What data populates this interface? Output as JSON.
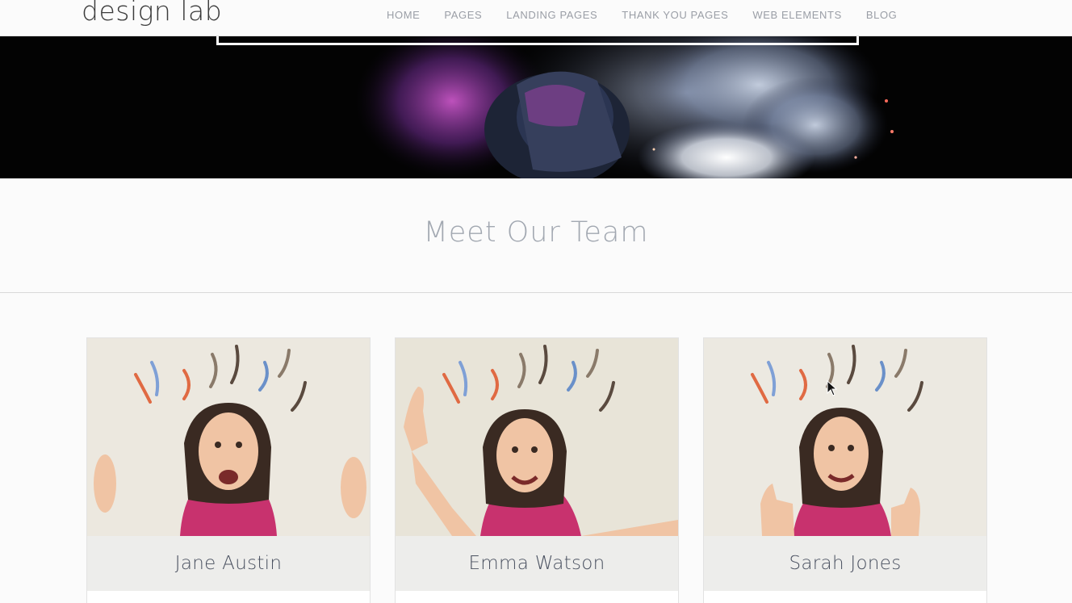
{
  "header": {
    "logo": "design lab",
    "nav": [
      "HOME",
      "PAGES",
      "LANDING PAGES",
      "THANK YOU PAGES",
      "WEB ELEMENTS",
      "BLOG"
    ]
  },
  "hero": {
    "image": "welder-sparks-smoke-photo"
  },
  "team": {
    "title": "Meet Our Team",
    "members": [
      {
        "name": "Jane Austin",
        "photo": "woman-surprised-hands-up-photo"
      },
      {
        "name": "Emma Watson",
        "photo": "woman-thumbs-up-photo"
      },
      {
        "name": "Sarah Jones",
        "photo": "woman-two-thumbs-up-photo"
      }
    ]
  },
  "colors": {
    "background": "#fbfbfb",
    "nav_text": "#9a9ea6",
    "title_text": "#a2a8b1",
    "name_bar": "#ededeb",
    "shirt": "#c8326e"
  }
}
